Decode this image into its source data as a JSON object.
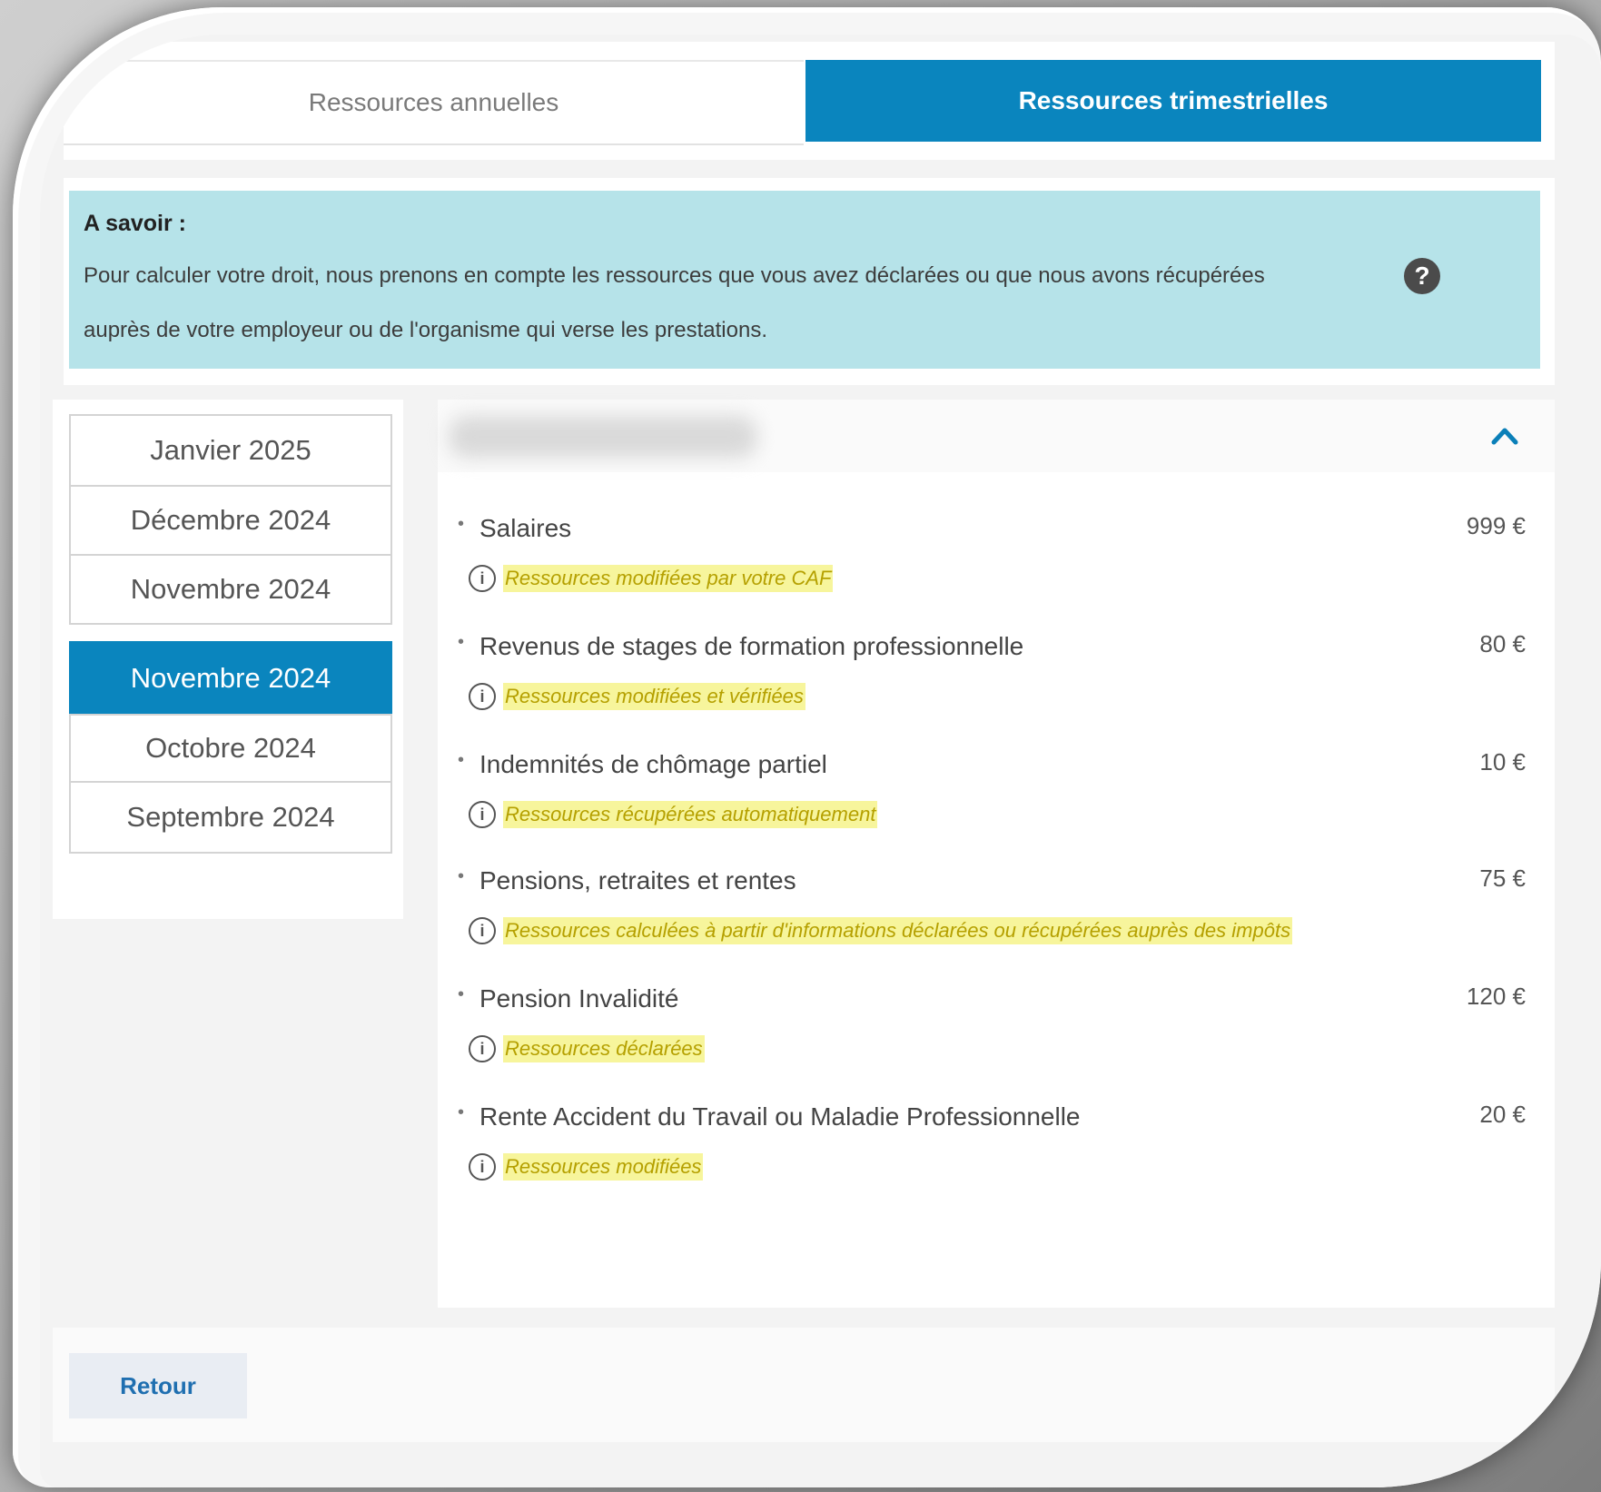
{
  "tabs": {
    "annual": "Ressources annuelles",
    "quarterly": "Ressources trimestrielles"
  },
  "info": {
    "title": "A savoir :",
    "line1": "Pour calculer votre droit, nous prenons en compte les ressources que vous avez déclarées ou que nous avons récupérées",
    "line2": "auprès de votre employeur ou de l'organisme qui verse les prestations.",
    "help_icon": "?"
  },
  "months": [
    {
      "label": "Janvier 2025",
      "active": false
    },
    {
      "label": "Décembre 2024",
      "active": false
    },
    {
      "label": "Novembre 2024",
      "active": false
    },
    {
      "label": "Novembre 2024",
      "active": true
    },
    {
      "label": "Octobre 2024",
      "active": false
    },
    {
      "label": "Septembre 2024",
      "active": false
    }
  ],
  "resources": [
    {
      "label": "Salaires",
      "amount": "999 €",
      "note": "Ressources modifiées par votre CAF"
    },
    {
      "label": "Revenus de stages de formation professionnelle",
      "amount": "80 €",
      "note": "Ressources modifiées et vérifiées"
    },
    {
      "label": "Indemnités de chômage partiel",
      "amount": "10 €",
      "note": "Ressources récupérées automatiquement"
    },
    {
      "label": "Pensions, retraites et rentes",
      "amount": "75 €",
      "note": "Ressources calculées à partir d'informations déclarées ou récupérées auprès des impôts"
    },
    {
      "label": "Pension Invalidité",
      "amount": "120 €",
      "note": "Ressources déclarées"
    },
    {
      "label": "Rente Accident du Travail ou Maladie Professionnelle",
      "amount": "20 €",
      "note": "Ressources modifiées"
    }
  ],
  "footer": {
    "back_label": "Retour"
  },
  "colors": {
    "primary": "#0a85be",
    "info_bg": "#b6e3e9",
    "highlight": "#f7f59c"
  },
  "icons": {
    "collapse": "chevron-up-icon",
    "info": "info-circle-icon",
    "help": "question-circle-icon"
  }
}
